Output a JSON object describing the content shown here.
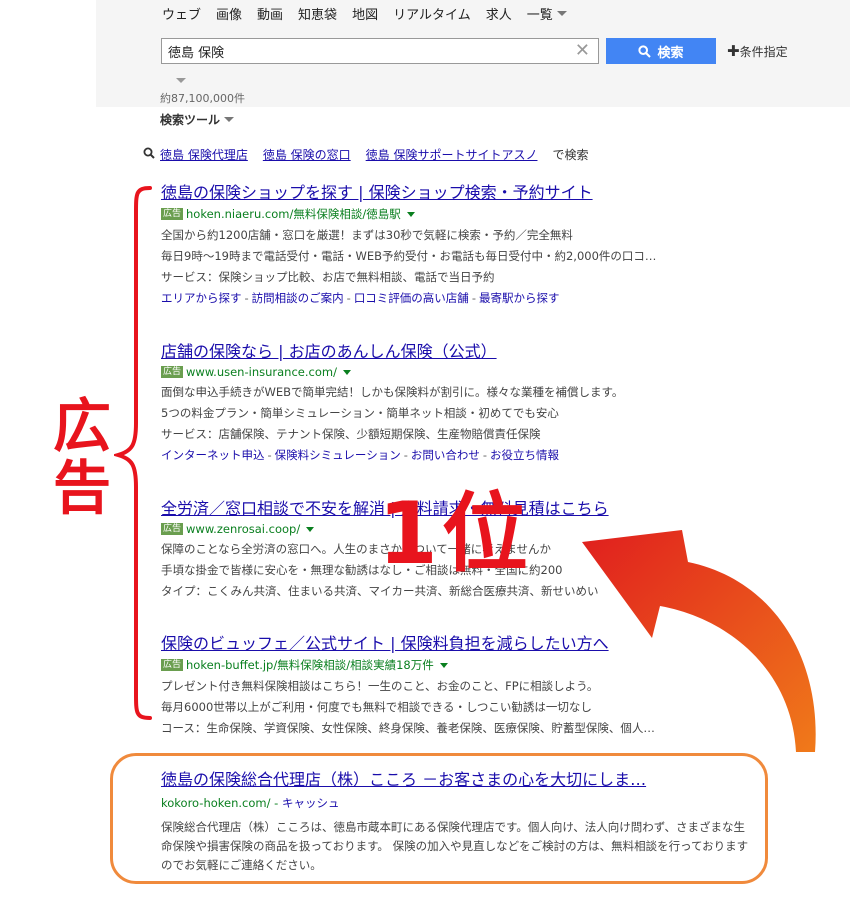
{
  "nav": [
    "ウェブ",
    "画像",
    "動画",
    "知恵袋",
    "地図",
    "リアルタイム",
    "求人"
  ],
  "nav_more": "一覧",
  "search": {
    "value": "徳島 保険",
    "button": "検索",
    "conditions": "条件指定"
  },
  "result_count": "約87,100,000件",
  "search_tools": "検索ツール",
  "related": {
    "items": [
      "徳島 保険代理店",
      "徳島 保険の窓口",
      "徳島 保険サポートサイトアスノ"
    ],
    "suffix": "で検索"
  },
  "ad_badge": "広告",
  "ads": [
    {
      "title": "徳島の保険ショップを探す | 保険ショップ検索・予約サイト",
      "url": "hoken.niaeru.com/無料保険相談/徳島駅",
      "lines": [
        "全国から約1200店舗・窓口を厳選！まずは30秒で気軽に検索・予約／完全無料",
        "毎日9時〜19時まで電話受付・電話・WEB予約受付・お電話も毎日受付中・約2,000件の口コ…",
        "サービス：保険ショップ比較、お店で無料相談、電話で当日予約"
      ],
      "links": [
        "エリアから探す",
        "訪問相談のご案内",
        "口コミ評価の高い店舗",
        "最寄駅から探す"
      ]
    },
    {
      "title": "店舗の保険なら | お店のあんしん保険（公式）",
      "url": "www.usen-insurance.com/",
      "lines": [
        "面倒な申込手続きがWEBで簡単完結！しかも保険料が割引に。様々な業種を補償します。",
        "5つの料金プラン・簡単シミュレーション・簡単ネット相談・初めてでも安心",
        "サービス：店舗保険、テナント保険、少額短期保険、生産物賠償責任保険"
      ],
      "links": [
        "インターネット申込",
        "保険料シミュレーション",
        "お問い合わせ",
        "お役立ち情報"
      ]
    },
    {
      "title": "全労済／窓口相談で不安を解消 | 資料請求・無料見積はこちら",
      "url": "www.zenrosai.coop/",
      "lines": [
        "保障のことなら全労済の窓口へ。人生のまさかについて一緒に考えませんか",
        "手頃な掛金で皆様に安心を・無理な勧誘はなし・ご相談は無料・全国に約200",
        "タイプ：こくみん共済、住まいる共済、マイカー共済、新総合医療共済、新せいめい"
      ],
      "links": []
    },
    {
      "title": "保険のビュッフェ／公式サイト | 保険料負担を減らしたい方へ",
      "url": "hoken-buffet.jp/無料保険相談/相談実績18万件",
      "lines": [
        "プレゼント付き無料保険相談はこちら！一生のこと、お金のこと、FPに相談しよう。",
        "毎月6000世帯以上がご利用・何度でも無料で相談できる・しつこい勧誘は一切なし",
        "コース：生命保険、学資保険、女性保険、終身保険、養老保険、医療保険、貯蓄型保険、個人…"
      ],
      "links": []
    }
  ],
  "organic": {
    "title": "徳島の保険総合代理店（株）こころ －お客さまの心を大切にしま…",
    "url": "kokoro-hoken.com/",
    "cache": "キャッシュ",
    "snippet": "保険総合代理店（株）こころは、徳島市蔵本町にある保険代理店です。個人向け、法人向け問わず、さまざまな生命保険や損害保険の商品を扱っております。 保険の加入や見直しなどをご検討の方は、無料相談を行っておりますのでお気軽にご連絡ください。"
  },
  "annotations": {
    "ad_label": "広告",
    "rank_label": "1位"
  },
  "colors": {
    "annotation_red": "#e8141d",
    "organic_frame": "#f08a3c",
    "link_blue": "#1a0dab",
    "url_green": "#0a7f1f"
  }
}
